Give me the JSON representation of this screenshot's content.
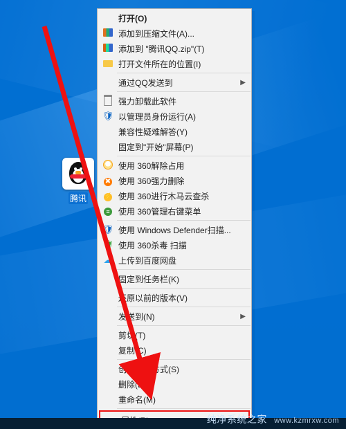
{
  "desktop_icon": {
    "label": "腾讯"
  },
  "menu": {
    "open": {
      "label": "打开(O)"
    },
    "add_archive": {
      "label": "添加到压缩文件(A)..."
    },
    "add_zip": {
      "label": "添加到 \"腾讯QQ.zip\"(T)"
    },
    "open_location": {
      "label": "打开文件所在的位置(I)"
    },
    "qq_send": {
      "label": "通过QQ发送到"
    },
    "force_uninstall": {
      "label": "强力卸载此软件"
    },
    "run_admin": {
      "label": "以管理员身份运行(A)"
    },
    "compat": {
      "label": "兼容性疑难解答(Y)"
    },
    "pin_start": {
      "label": "固定到\"开始\"屏幕(P)"
    },
    "360_unlock": {
      "label": "使用 360解除占用"
    },
    "360_forcedel": {
      "label": "使用 360强力删除"
    },
    "360_trojan": {
      "label": "使用 360进行木马云查杀"
    },
    "360_menu": {
      "label": "使用 360管理右键菜单"
    },
    "defender": {
      "label": "使用 Windows Defender扫描..."
    },
    "360_av": {
      "label": "使用 360杀毒 扫描"
    },
    "baidu_upload": {
      "label": "上传到百度网盘"
    },
    "pin_taskbar": {
      "label": "固定到任务栏(K)"
    },
    "restore_prev": {
      "label": "还原以前的版本(V)"
    },
    "send_to": {
      "label": "发送到(N)"
    },
    "cut": {
      "label": "剪切(T)"
    },
    "copy": {
      "label": "复制(C)"
    },
    "create_shortcut": {
      "label": "创建快捷方式(S)"
    },
    "delete": {
      "label": "删除(D)"
    },
    "rename": {
      "label": "重命名(M)"
    },
    "properties": {
      "label": "属性(R)"
    }
  },
  "watermark": {
    "brand": "纯净系统之家",
    "domain": "www.kzmrxw.com"
  }
}
